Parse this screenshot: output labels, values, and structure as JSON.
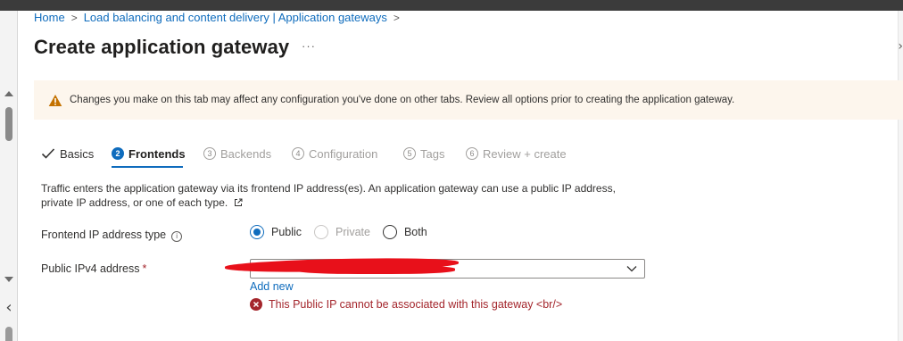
{
  "breadcrumb": {
    "home": "Home",
    "level1": "Load balancing and content delivery | Application gateways",
    "sep": ">"
  },
  "page": {
    "title": "Create application gateway",
    "more": "···"
  },
  "warning": {
    "text": "Changes you make on this tab may affect any configuration you've done on other tabs. Review all options prior to creating the application gateway."
  },
  "tabs": [
    {
      "label": "Basics",
      "state": "done"
    },
    {
      "number": "2",
      "label": "Frontends",
      "state": "active"
    },
    {
      "number": "3",
      "label": "Backends",
      "state": "disabled"
    },
    {
      "number": "4",
      "label": "Configuration",
      "state": "disabled"
    },
    {
      "number": "5",
      "label": "Tags",
      "state": "disabled"
    },
    {
      "number": "6",
      "label": "Review + create",
      "state": "disabled"
    }
  ],
  "description": {
    "text": "Traffic enters the application gateway via its frontend IP address(es). An application gateway can use a public IP address, private IP address, or one of each type."
  },
  "frontend_type": {
    "label": "Frontend IP address type",
    "options": [
      {
        "label": "Public",
        "checked": true,
        "disabled": false
      },
      {
        "label": "Private",
        "checked": false,
        "disabled": true
      },
      {
        "label": "Both",
        "checked": false,
        "disabled": false
      }
    ]
  },
  "public_ip": {
    "label": "Public IPv4 address",
    "required_mark": "*",
    "value": "",
    "add_new": "Add new",
    "error": "This Public IP cannot be associated with this gateway <br/>"
  },
  "colors": {
    "accent": "#0f6cbd",
    "warning_bg": "#fdf6ed",
    "warning_icon": "#c47200",
    "error": "#a4262c",
    "redaction": "#e8101a"
  }
}
